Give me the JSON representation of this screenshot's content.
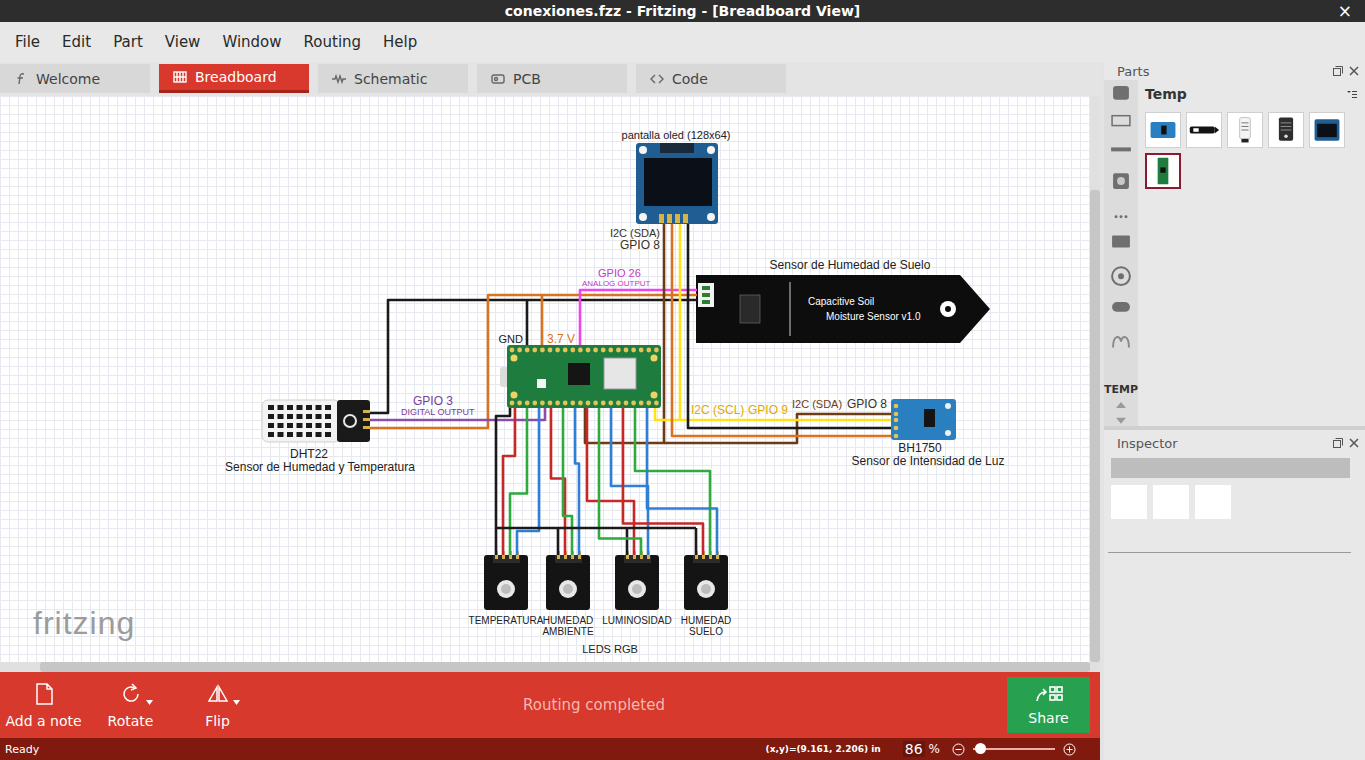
{
  "window": {
    "title": "conexiones.fzz - Fritzing - [Breadboard View]",
    "close": "×"
  },
  "menu": [
    "File",
    "Edit",
    "Part",
    "View",
    "Window",
    "Routing",
    "Help"
  ],
  "tabs": [
    {
      "label": "Welcome",
      "selected": false
    },
    {
      "label": "Breadboard",
      "selected": true
    },
    {
      "label": "Schematic",
      "selected": false
    },
    {
      "label": "PCB",
      "selected": false
    },
    {
      "label": "Code",
      "selected": false
    }
  ],
  "canvas": {
    "watermark": "fritzing",
    "oled": {
      "label": "pantalla oled (128x64)"
    },
    "soil_sensor": {
      "title": "Sensor de Humedad de Suelo",
      "board_text": [
        "Capacitive Soil",
        "Moisture Sensor v1.0"
      ]
    },
    "dht22": {
      "name": "DHT22",
      "description": "Sensor de Humedad y Temperatura"
    },
    "bh1750": {
      "name": "BH1750",
      "description": "Sensor de Intensidad de Luz"
    },
    "annotations": [
      {
        "text": "I2C (SDA)",
        "color": "#3a3226"
      },
      {
        "text": "GPIO 8",
        "color": "#3a3226"
      },
      {
        "text": "GPIO 26",
        "color": "#c23cc2"
      },
      {
        "text": "ANALOG OUTPUT",
        "color": "#c23cc2"
      },
      {
        "text": "GND",
        "color": "#1a1a1a"
      },
      {
        "text": "3.7 V",
        "color": "#d9731f"
      },
      {
        "text": "GPIO 3",
        "color": "#7a3e98"
      },
      {
        "text": "DIGITAL OUTPUT",
        "color": "#7a3e98"
      },
      {
        "text": "I2C (SCL)",
        "color": "#e0a800"
      },
      {
        "text": "GPIO 9",
        "color": "#e0a800"
      },
      {
        "text": "I2C (SDA)",
        "color": "#6e3b17"
      },
      {
        "text": "GPIO 8",
        "color": "#3a3226"
      }
    ],
    "wires": [
      {
        "color": "#1a1a1a"
      },
      {
        "color": "#1a1a1a"
      },
      {
        "color": "#d9731f"
      },
      {
        "color": "#d9731f"
      },
      {
        "color": "#ee44ee"
      },
      {
        "color": "#8e4ba8"
      },
      {
        "color": "#6e3b17"
      },
      {
        "color": "#6e3b17"
      },
      {
        "color": "#ffe31a"
      },
      {
        "color": "#ffe31a"
      },
      {
        "color": "#1a1a1a"
      },
      {
        "color": "#d9731f"
      }
    ],
    "leds": [
      {
        "lines": [
          "TEMPERATURA"
        ]
      },
      {
        "lines": [
          "HUMEDAD",
          "AMBIENTE"
        ]
      },
      {
        "lines": [
          "LUMINOSIDAD"
        ]
      },
      {
        "lines": [
          "HUMEDAD",
          "SUELO"
        ]
      }
    ],
    "led_pin_wires": [
      {
        "color": "#1a1a1a"
      },
      {
        "color": "#c62828"
      },
      {
        "color": "#2eaa3e"
      },
      {
        "color": "#2f7fd6"
      }
    ],
    "leds_label": "LEDS RGB"
  },
  "toolbar": {
    "buttons": [
      {
        "label": "Add a note",
        "has_menu": false
      },
      {
        "label": "Rotate",
        "has_menu": true
      },
      {
        "label": "Flip",
        "has_menu": true
      }
    ],
    "message": "Routing completed",
    "share": "Share"
  },
  "status_bar": {
    "text": "Ready",
    "coordinates": "(x,y)=(9.161, 2.206) in",
    "zoom": "86",
    "zoom_unit": "%",
    "zoom_level": 0.03
  },
  "parts_panel": {
    "title": "Parts",
    "bin": "Temp",
    "bin_tab": "TEMP",
    "items": [
      {
        "kind": "bh1750",
        "selected": false
      },
      {
        "kind": "probe",
        "selected": false
      },
      {
        "kind": "dht-white",
        "selected": false
      },
      {
        "kind": "dht-black",
        "selected": false
      },
      {
        "kind": "oled",
        "selected": false
      },
      {
        "kind": "pico",
        "selected": true
      }
    ]
  },
  "inspector": {
    "title": "Inspector"
  }
}
